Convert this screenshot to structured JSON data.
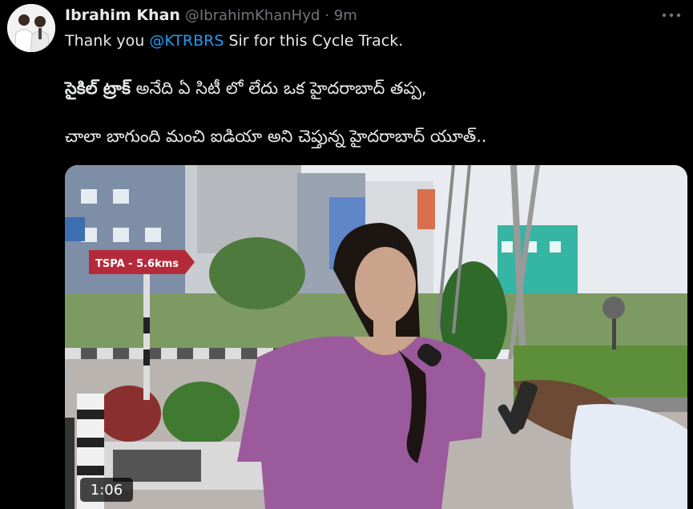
{
  "tweet": {
    "author_name": "Ibrahim Khan",
    "handle": "@IbrahimKhanHyd",
    "time": "· 9m",
    "line1_before": "Thank you ",
    "line1_mention": "@KTRBRS",
    "line1_after": " Sir for this Cycle Track.",
    "line2_bold": "సైకిల్ ట్రాక్",
    "line2_rest": " అనేది ఏ సిటీ లో లేదు ఒక హైదరాబాద్ తప్ప,",
    "line3": "చాలా బాగుంది మంచి ఐడియా అని చెప్తున్న హైదరాబాద్ యూత్.."
  },
  "media": {
    "video_duration": "1:06",
    "sign_text": "TSPA - 5.6kms"
  },
  "icons": {
    "more": "more-options-icon",
    "avatar": "avatar"
  },
  "colors": {
    "background": "#000000",
    "text": "#e7e9ea",
    "secondary": "#71767b",
    "link": "#1d9bf0",
    "shirt": "#9b5a9b",
    "sign": "#b52a3a"
  }
}
